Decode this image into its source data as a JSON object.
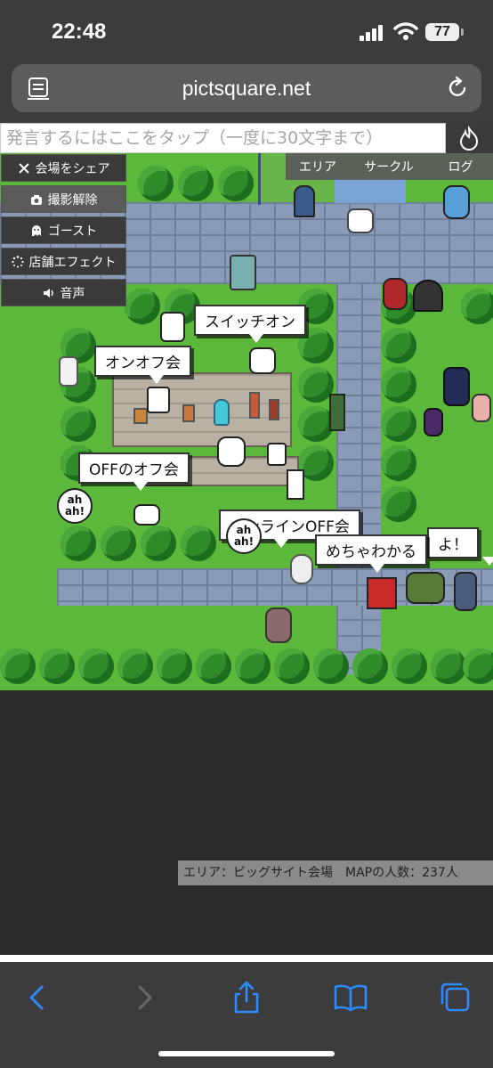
{
  "status_bar": {
    "time": "22:48",
    "battery": "77"
  },
  "browser": {
    "url": "pictsquare.net"
  },
  "chat": {
    "placeholder": "発言するにはここをタップ（一度に30文字まで）"
  },
  "actions": [
    {
      "label": "会場をシェア",
      "icon": "x-logo-icon"
    },
    {
      "label": "撮影解除",
      "icon": "camera-icon"
    },
    {
      "label": "ゴースト",
      "icon": "ghost-icon"
    },
    {
      "label": "店舗エフェクト",
      "icon": "sparkle-loader-icon"
    },
    {
      "label": "音声",
      "icon": "speaker-icon"
    }
  ],
  "top_menu": [
    "エリア",
    "サークル",
    "ログ"
  ],
  "bubbles": {
    "switch_on": "スイッチオン",
    "onoff": "オンオフ会",
    "off_off": "OFFのオフ会",
    "online_off": "オンラインOFF会",
    "mechawakaru": "めちゃわかる",
    "cut_exclaim": "よ！",
    "ahah": "ah ah!"
  },
  "info": {
    "text": "エリア：ビッグサイト会場　MAPの人数：237人"
  },
  "colors": {
    "grass": "#5cb83a",
    "road": "#8a9bb8",
    "accent_blue": "#2e8bff"
  }
}
